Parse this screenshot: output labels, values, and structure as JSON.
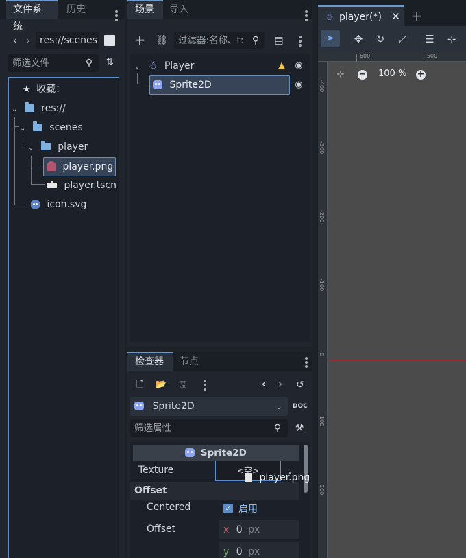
{
  "filesystem": {
    "tabs": [
      "文件系统",
      "历史"
    ],
    "path": "res://scenes",
    "filter_placeholder": "筛选文件",
    "favorites_label": "收藏：",
    "items": [
      {
        "label": "res://"
      },
      {
        "label": "scenes"
      },
      {
        "label": "player"
      },
      {
        "label": "player.png"
      },
      {
        "label": "player.tscn"
      },
      {
        "label": "icon.svg"
      }
    ]
  },
  "scene": {
    "tabs": [
      "场景",
      "导入"
    ],
    "filter_placeholder": "过滤器:名称、t:",
    "nodes": [
      {
        "label": "Player"
      },
      {
        "label": "Sprite2D"
      }
    ]
  },
  "inspector": {
    "tabs": [
      "检查器",
      "节点"
    ],
    "node_select": "Sprite2D",
    "filter_placeholder": "筛选属性",
    "section_title": "Sprite2D",
    "texture_label": "Texture",
    "texture_value": "<空>",
    "offset_group": "Offset",
    "centered_label": "Centered",
    "centered_value": "启用",
    "offset_label": "Offset",
    "offset_x_axis": "x",
    "offset_x": "0",
    "offset_y_axis": "y",
    "offset_y": "0",
    "unit": "px",
    "drag_label": "player.png"
  },
  "editor": {
    "tab_title": "player(*)",
    "zoom": "100 %",
    "ruler_top": [
      "-600",
      "-500"
    ],
    "ruler_left": [
      "-400",
      "-300",
      "-200",
      "-100",
      "0",
      "100",
      "200"
    ]
  },
  "colors": {
    "accent": "#6b9ad2",
    "warning": "#f2c84b",
    "axis_red": "#c0404a"
  }
}
